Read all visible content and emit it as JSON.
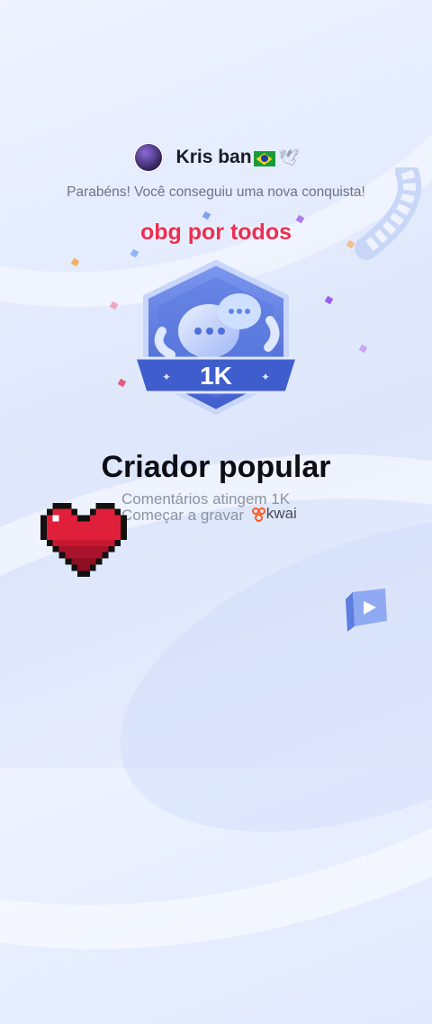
{
  "post": {
    "username": "Kris ban",
    "flag_icon": "brazil-flag-icon",
    "dove_icon": "dove-icon",
    "subtitle": "Parabéns! Você conseguiu uma nova conquista!",
    "overlay_text": "obg por todos"
  },
  "achievement": {
    "badge_label": "1K",
    "title": "Criador popular",
    "description": "Comentários atingem 1K",
    "cta": "Começar a gravar",
    "brand": "kwai"
  },
  "colors": {
    "overlay_text": "#ee2d52",
    "badge_primary": "#4f6fd8",
    "brand_orange": "#ff5b1f"
  }
}
